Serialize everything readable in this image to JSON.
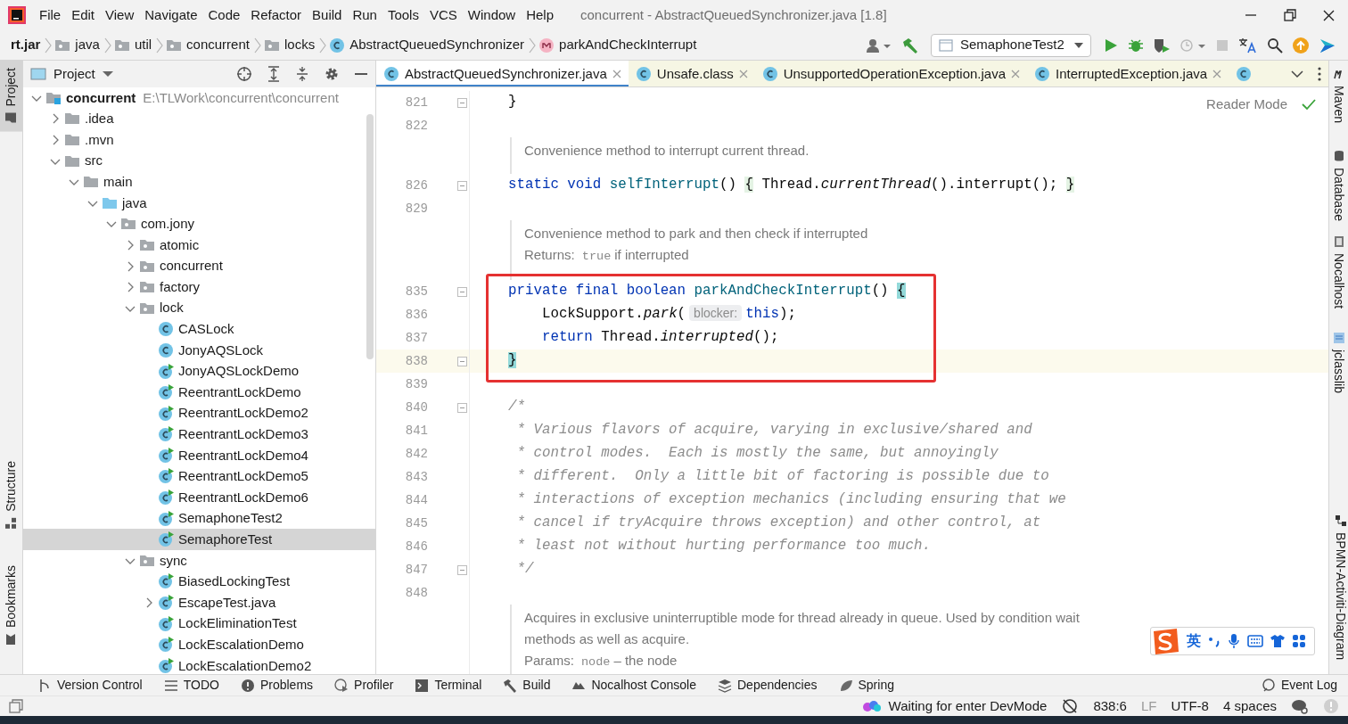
{
  "window": {
    "title": "concurrent - AbstractQueuedSynchronizer.java [1.8]"
  },
  "menu": [
    "File",
    "Edit",
    "View",
    "Navigate",
    "Code",
    "Refactor",
    "Build",
    "Run",
    "Tools",
    "VCS",
    "Window",
    "Help"
  ],
  "breadcrumbs": [
    {
      "label": "rt.jar",
      "kind": "archive"
    },
    {
      "label": "java",
      "kind": "package"
    },
    {
      "label": "util",
      "kind": "package"
    },
    {
      "label": "concurrent",
      "kind": "package"
    },
    {
      "label": "locks",
      "kind": "package"
    },
    {
      "label": "AbstractQueuedSynchronizer",
      "kind": "class"
    },
    {
      "label": "parkAndCheckInterrupt",
      "kind": "method"
    }
  ],
  "run_config": {
    "value": "SemaphoneTest2"
  },
  "left_tool_strip": [
    {
      "label": "Project",
      "selected": true
    },
    {
      "label": "Structure",
      "selected": false
    },
    {
      "label": "Bookmarks",
      "selected": false
    }
  ],
  "project_panel": {
    "title": "Project",
    "tree": [
      {
        "label": "concurrent",
        "path": "E:\\TLWork\\concurrent\\concurrent",
        "kind": "module",
        "expanded": true,
        "selected": false,
        "children": [
          {
            "label": ".idea",
            "kind": "folder",
            "expanded": false,
            "selected": false
          },
          {
            "label": ".mvn",
            "kind": "folder",
            "expanded": false,
            "selected": false
          },
          {
            "label": "src",
            "kind": "folder",
            "expanded": true,
            "selected": false,
            "children": [
              {
                "label": "main",
                "kind": "folder",
                "expanded": true,
                "selected": false,
                "children": [
                  {
                    "label": "java",
                    "kind": "source",
                    "expanded": true,
                    "selected": false,
                    "children": [
                      {
                        "label": "com.jony",
                        "kind": "package",
                        "expanded": true,
                        "selected": false,
                        "children": [
                          {
                            "label": "atomic",
                            "kind": "package",
                            "expanded": false,
                            "selected": false
                          },
                          {
                            "label": "concurrent",
                            "kind": "package",
                            "expanded": false,
                            "selected": false
                          },
                          {
                            "label": "factory",
                            "kind": "package",
                            "expanded": false,
                            "selected": false
                          },
                          {
                            "label": "lock",
                            "kind": "package",
                            "expanded": true,
                            "selected": false,
                            "children": [
                              {
                                "label": "CASLock",
                                "kind": "class",
                                "selected": false
                              },
                              {
                                "label": "JonyAQSLock",
                                "kind": "class",
                                "selected": false
                              },
                              {
                                "label": "JonyAQSLockDemo",
                                "kind": "runnable",
                                "selected": false
                              },
                              {
                                "label": "ReentrantLockDemo",
                                "kind": "runnable",
                                "selected": false
                              },
                              {
                                "label": "ReentrantLockDemo2",
                                "kind": "runnable",
                                "selected": false
                              },
                              {
                                "label": "ReentrantLockDemo3",
                                "kind": "runnable",
                                "selected": false
                              },
                              {
                                "label": "ReentrantLockDemo4",
                                "kind": "runnable",
                                "selected": false
                              },
                              {
                                "label": "ReentrantLockDemo5",
                                "kind": "runnable",
                                "selected": false
                              },
                              {
                                "label": "ReentrantLockDemo6",
                                "kind": "runnable",
                                "selected": false
                              },
                              {
                                "label": "SemaphoneTest2",
                                "kind": "runnable",
                                "selected": false
                              },
                              {
                                "label": "SemaphoreTest",
                                "kind": "runnable",
                                "selected": true
                              }
                            ]
                          },
                          {
                            "label": "sync",
                            "kind": "package",
                            "expanded": true,
                            "selected": false,
                            "children": [
                              {
                                "label": "BiasedLockingTest",
                                "kind": "runnable",
                                "selected": false
                              },
                              {
                                "label": "EscapeTest.java",
                                "kind": "runnable",
                                "expanded": false,
                                "selected": false
                              },
                              {
                                "label": "LockEliminationTest",
                                "kind": "runnable",
                                "selected": false
                              },
                              {
                                "label": "LockEscalationDemo",
                                "kind": "runnable",
                                "selected": false
                              },
                              {
                                "label": "LockEscalationDemo2",
                                "kind": "runnable",
                                "selected": false
                              }
                            ]
                          }
                        ]
                      }
                    ]
                  }
                ]
              }
            ]
          }
        ]
      }
    ]
  },
  "editor": {
    "tabs": [
      {
        "label": "AbstractQueuedSynchronizer.java",
        "selected": true
      },
      {
        "label": "Unsafe.class",
        "selected": false
      },
      {
        "label": "UnsupportedOperationException.java",
        "selected": false
      },
      {
        "label": "InterruptedException.java",
        "selected": false
      }
    ],
    "reader_mode": "Reader Mode",
    "lines": [
      {
        "kind": "code",
        "number": "821",
        "fold": true,
        "current": false,
        "framed": false,
        "segments": [
          {
            "kind": "plain",
            "text": "}"
          }
        ]
      },
      {
        "kind": "code",
        "number": "822",
        "fold": false,
        "current": false,
        "framed": false
      },
      {
        "kind": "doc",
        "paragraphs": [
          [
            {
              "kind": "text",
              "text": "Convenience method to interrupt current thread."
            }
          ]
        ]
      },
      {
        "kind": "code",
        "number": "826",
        "fold": true,
        "current": false,
        "framed": false,
        "segments": [
          {
            "kind": "kw",
            "text": "static void"
          },
          {
            "kind": "method",
            "text": " selfInterrupt"
          },
          {
            "kind": "plain",
            "text": "() "
          },
          {
            "kind": "fold",
            "text": "{"
          },
          {
            "kind": "plain",
            "text": " Thread."
          },
          {
            "kind": "italic",
            "text": "currentThread"
          },
          {
            "kind": "plain",
            "text": "().interrupt(); "
          },
          {
            "kind": "fold",
            "text": "}"
          }
        ]
      },
      {
        "kind": "code",
        "number": "829",
        "fold": false,
        "current": false,
        "framed": false
      },
      {
        "kind": "doc",
        "paragraphs": [
          [
            {
              "kind": "text",
              "text": "Convenience method to park and then check if interrupted"
            }
          ],
          [
            {
              "kind": "label",
              "text": "Returns:"
            },
            {
              "kind": "code",
              "text": "true"
            },
            {
              "kind": "text",
              "text": "if interrupted"
            }
          ]
        ]
      },
      {
        "kind": "code",
        "number": "835",
        "fold": true,
        "current": false,
        "framed": true,
        "segments": [
          {
            "kind": "kw",
            "text": "private final boolean"
          },
          {
            "kind": "method",
            "text": " parkAndCheckInterrupt"
          },
          {
            "kind": "plain",
            "text": "() "
          },
          {
            "kind": "brace",
            "text": "{"
          }
        ]
      },
      {
        "kind": "code",
        "number": "836",
        "fold": false,
        "current": false,
        "framed": true,
        "segments": [
          {
            "kind": "plain",
            "text": "    LockSupport."
          },
          {
            "kind": "italic",
            "text": "park"
          },
          {
            "kind": "plain",
            "text": "("
          },
          {
            "kind": "hint",
            "text": "blocker:"
          },
          {
            "kind": "kw",
            "text": "this"
          },
          {
            "kind": "plain",
            "text": ");"
          }
        ]
      },
      {
        "kind": "code",
        "number": "837",
        "fold": false,
        "current": false,
        "framed": true,
        "segments": [
          {
            "kind": "kw",
            "text": "    return"
          },
          {
            "kind": "plain",
            "text": " Thread."
          },
          {
            "kind": "italic",
            "text": "interrupted"
          },
          {
            "kind": "plain",
            "text": "();"
          }
        ]
      },
      {
        "kind": "code",
        "number": "838",
        "fold": true,
        "current": true,
        "framed": true,
        "segments": [
          {
            "kind": "brace",
            "text": "}"
          }
        ]
      },
      {
        "kind": "code",
        "number": "839",
        "fold": false,
        "current": false,
        "framed": false
      },
      {
        "kind": "code",
        "number": "840",
        "fold": true,
        "current": false,
        "framed": false,
        "segments": [
          {
            "kind": "comment",
            "text": "/*"
          }
        ]
      },
      {
        "kind": "code",
        "number": "841",
        "fold": false,
        "current": false,
        "framed": false,
        "segments": [
          {
            "kind": "comment",
            "text": " * Various flavors of acquire, varying in exclusive/shared and"
          }
        ]
      },
      {
        "kind": "code",
        "number": "842",
        "fold": false,
        "current": false,
        "framed": false,
        "segments": [
          {
            "kind": "comment",
            "text": " * control modes.  Each is mostly the same, but annoyingly"
          }
        ]
      },
      {
        "kind": "code",
        "number": "843",
        "fold": false,
        "current": false,
        "framed": false,
        "segments": [
          {
            "kind": "comment",
            "text": " * different.  Only a little bit of factoring is possible due to"
          }
        ]
      },
      {
        "kind": "code",
        "number": "844",
        "fold": false,
        "current": false,
        "framed": false,
        "segments": [
          {
            "kind": "comment",
            "text": " * interactions of exception mechanics (including ensuring that we"
          }
        ]
      },
      {
        "kind": "code",
        "number": "845",
        "fold": false,
        "current": false,
        "framed": false,
        "segments": [
          {
            "kind": "comment",
            "text": " * cancel if tryAcquire throws exception) and other control, at"
          }
        ]
      },
      {
        "kind": "code",
        "number": "846",
        "fold": false,
        "current": false,
        "framed": false,
        "segments": [
          {
            "kind": "comment",
            "text": " * least not without hurting performance too much."
          }
        ]
      },
      {
        "kind": "code",
        "number": "847",
        "fold": true,
        "current": false,
        "framed": false,
        "segments": [
          {
            "kind": "comment",
            "text": " */"
          }
        ]
      },
      {
        "kind": "code",
        "number": "848",
        "fold": false,
        "current": false,
        "framed": false
      },
      {
        "kind": "doc",
        "paragraphs": [
          [
            {
              "kind": "text",
              "text": "Acquires in exclusive uninterruptible mode for thread already in queue. Used by condition wait methods as well as acquire."
            }
          ],
          [
            {
              "kind": "label",
              "text": "Params:"
            },
            {
              "kind": "code",
              "text": "node"
            },
            {
              "kind": "text",
              "text": "– the node"
            }
          ]
        ]
      }
    ]
  },
  "right_tool_strip": [
    {
      "label": "Maven",
      "kind": "maven"
    },
    {
      "label": "Database",
      "kind": "database"
    },
    {
      "label": "Nocalhost",
      "kind": "nocalhost"
    },
    {
      "label": "jclasslib",
      "kind": "jclasslib"
    },
    {
      "label": "BPMN-Activiti-Diagram",
      "kind": "bpmn"
    }
  ],
  "ime_toolbar": {
    "mode": "英"
  },
  "bottom_tools": [
    {
      "label": "Version Control",
      "kind": "vcs"
    },
    {
      "label": "TODO",
      "kind": "todo"
    },
    {
      "label": "Problems",
      "kind": "problems"
    },
    {
      "label": "Profiler",
      "kind": "profiler"
    },
    {
      "label": "Terminal",
      "kind": "terminal"
    },
    {
      "label": "Build",
      "kind": "build"
    },
    {
      "label": "Nocalhost Console",
      "kind": "nocalhost"
    },
    {
      "label": "Dependencies",
      "kind": "dependencies"
    },
    {
      "label": "Spring",
      "kind": "spring"
    },
    {
      "label": "Event Log",
      "kind": "log"
    }
  ],
  "status_bar": {
    "message": "Waiting for enter DevMode",
    "position": "838:6",
    "line_separator": "LF",
    "encoding": "UTF-8",
    "indent": "4 spaces"
  }
}
